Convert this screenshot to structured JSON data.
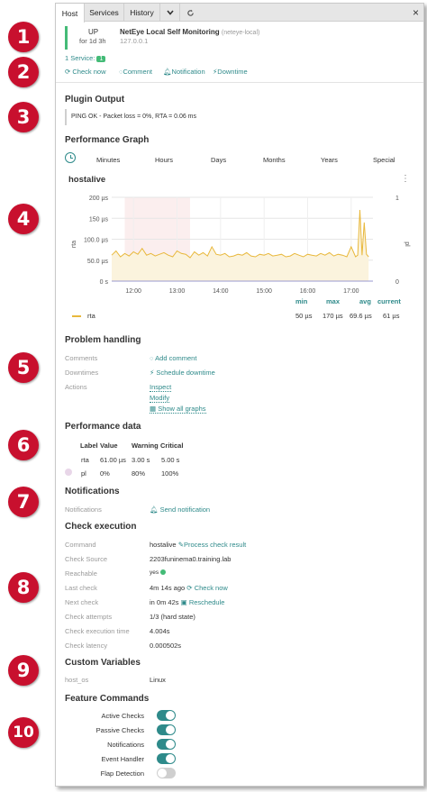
{
  "badges": [
    "1",
    "2",
    "3",
    "4",
    "5",
    "6",
    "7",
    "8",
    "9",
    "10"
  ],
  "tabs": [
    {
      "label": "Host"
    },
    {
      "label": "Services"
    },
    {
      "label": "History"
    }
  ],
  "close": "×",
  "host": {
    "state": "UP",
    "duration": "for 1d 3h",
    "name": "NetEye Local Self Monitoring",
    "hostname": "(neteye-local)",
    "address": "127.0.0.1",
    "services_label": "1 Service:",
    "services_count": "1",
    "state_color": "#44bb77"
  },
  "actions": {
    "check_now": "Check now",
    "comment": "Comment",
    "notification": "Notification",
    "downtime": "Downtime"
  },
  "plugin": {
    "title": "Plugin Output",
    "output": "PING OK - Packet loss = 0%, RTA = 0.06 ms"
  },
  "perfgraph": {
    "title": "Performance Graph",
    "ranges": [
      "Minutes",
      "Hours",
      "Days",
      "Months",
      "Years",
      "Special"
    ],
    "graph_title": "hostalive",
    "more": "⋮",
    "yleft_label": "rta",
    "yright_label": "pl",
    "legend": {
      "headers": [
        "min",
        "max",
        "avg",
        "current"
      ],
      "series": "rta",
      "values": [
        "50 µs",
        "170 µs",
        "69.6 µs",
        "61 µs"
      ],
      "color": "#e8b83c"
    }
  },
  "chart_data": {
    "type": "line",
    "xticks": [
      "12:00",
      "13:00",
      "14:00",
      "15:00",
      "16:00",
      "17:00"
    ],
    "yticks_left": [
      "200 µs",
      "150 µs",
      "100.0 µs",
      "50.0 µs",
      "0 s"
    ],
    "yticks_right": [
      "1",
      "0"
    ],
    "ylim": [
      0,
      200
    ],
    "xlim": [
      11.5,
      17.5
    ],
    "x": [
      11.5,
      11.6,
      11.7,
      11.8,
      11.9,
      12.0,
      12.1,
      12.2,
      12.3,
      12.4,
      12.5,
      12.6,
      12.7,
      12.8,
      12.9,
      13.0,
      13.1,
      13.2,
      13.3,
      13.4,
      13.5,
      13.6,
      13.7,
      13.8,
      13.9,
      14.0,
      14.1,
      14.2,
      14.3,
      14.4,
      14.5,
      14.6,
      14.7,
      14.8,
      14.9,
      15.0,
      15.1,
      15.2,
      15.3,
      15.4,
      15.5,
      15.6,
      15.7,
      15.8,
      15.9,
      16.0,
      16.1,
      16.2,
      16.3,
      16.4,
      16.5,
      16.6,
      16.7,
      16.8,
      16.9,
      17.0,
      17.05,
      17.1,
      17.15,
      17.2,
      17.25,
      17.3,
      17.35,
      17.4
    ],
    "series": [
      {
        "values": [
          62,
          72,
          58,
          66,
          60,
          70,
          64,
          78,
          62,
          66,
          60,
          64,
          68,
          62,
          58,
          72,
          66,
          64,
          56,
          70,
          62,
          68,
          60,
          82,
          64,
          62,
          66,
          58,
          60,
          64,
          62,
          68,
          60,
          58,
          64,
          62,
          66,
          60,
          62,
          64,
          58,
          60,
          66,
          62,
          58,
          64,
          62,
          60,
          66,
          62,
          68,
          60,
          64,
          62,
          58,
          82,
          70,
          58,
          62,
          170,
          62,
          140,
          64,
          58
        ]
      }
    ]
  },
  "problem": {
    "title": "Problem handling",
    "comments_label": "Comments",
    "add_comment": "Add comment",
    "downtimes_label": "Downtimes",
    "schedule_downtime": "Schedule downtime",
    "actions_label": "Actions",
    "inspect": "Inspect",
    "modify": "Modify",
    "show_graphs": "Show all graphs"
  },
  "perfdata": {
    "title": "Performance data",
    "headers": [
      "Label",
      "Value",
      "Warning",
      "Critical"
    ],
    "rows": [
      {
        "label": "rta",
        "value": "61.00 µs",
        "warning": "3.00 s",
        "critical": "5.00 s"
      },
      {
        "label": "pl",
        "value": "0%",
        "warning": "80%",
        "critical": "100%"
      }
    ]
  },
  "notifications": {
    "title": "Notifications",
    "label": "Notifications",
    "send": "Send notification"
  },
  "check": {
    "title": "Check execution",
    "rows": [
      {
        "label": "Command",
        "value": "hostalive",
        "link": "Process check result"
      },
      {
        "label": "Check Source",
        "value": "2203funinema0.training.lab",
        "link": ""
      },
      {
        "label": "Reachable",
        "value": "yes",
        "link": ""
      },
      {
        "label": "Last check",
        "value": "4m 14s ago",
        "link": "Check now"
      },
      {
        "label": "Next check",
        "value": "in 0m 42s",
        "link": "Reschedule"
      },
      {
        "label": "Check attempts",
        "value": "1/3 (hard state)",
        "link": ""
      },
      {
        "label": "Check execution time",
        "value": "4.004s",
        "link": ""
      },
      {
        "label": "Check latency",
        "value": "0.000502s",
        "link": ""
      }
    ]
  },
  "custom": {
    "title": "Custom Variables",
    "label": "host_os",
    "value": "Linux"
  },
  "features": {
    "title": "Feature Commands",
    "items": [
      {
        "label": "Active Checks",
        "on": true
      },
      {
        "label": "Passive Checks",
        "on": true
      },
      {
        "label": "Notifications",
        "on": true
      },
      {
        "label": "Event Handler",
        "on": true
      },
      {
        "label": "Flap Detection",
        "on": false
      }
    ]
  }
}
